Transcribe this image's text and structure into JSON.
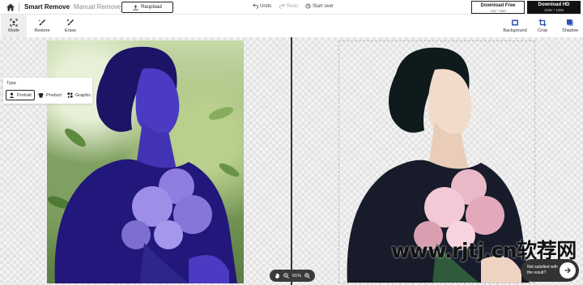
{
  "header": {
    "tabs": [
      {
        "label": "Smart Remove",
        "active": true
      },
      {
        "label": "Manual Remove",
        "active": false
      }
    ],
    "reupload_label": "Reupload",
    "undo_label": "Undo",
    "redo_label": "Redo",
    "startover_label": "Start over",
    "download_free": {
      "label": "Download Free",
      "size": "449 * 550"
    },
    "download_hd": {
      "label": "Download HD",
      "size": "1036 * 1280"
    }
  },
  "toolbar": {
    "left": [
      {
        "label": "Mode",
        "icon": "mode-icon",
        "active": true
      },
      {
        "label": "Restore",
        "icon": "restore-brush-icon"
      },
      {
        "label": "Erase",
        "icon": "erase-brush-icon"
      }
    ],
    "right": [
      {
        "label": "Background",
        "icon": "background-icon"
      },
      {
        "label": "Crop",
        "icon": "crop-icon"
      },
      {
        "label": "Shadow",
        "icon": "shadow-icon"
      }
    ]
  },
  "type_panel": {
    "title": "Type",
    "options": [
      {
        "label": "Portrait",
        "icon": "person-icon",
        "selected": true
      },
      {
        "label": "Product",
        "icon": "shirt-icon",
        "selected": false
      },
      {
        "label": "Graphic",
        "icon": "graphic-icon",
        "selected": false
      }
    ]
  },
  "zoom": {
    "value": "61%"
  },
  "feedback": {
    "line1": "Not satisfied with",
    "line2": "the result?"
  },
  "watermark": "www.rjtj.cn软荐网",
  "colors": {
    "accent_dark": "#111111",
    "mask_overlay": "#2a1e8f"
  }
}
